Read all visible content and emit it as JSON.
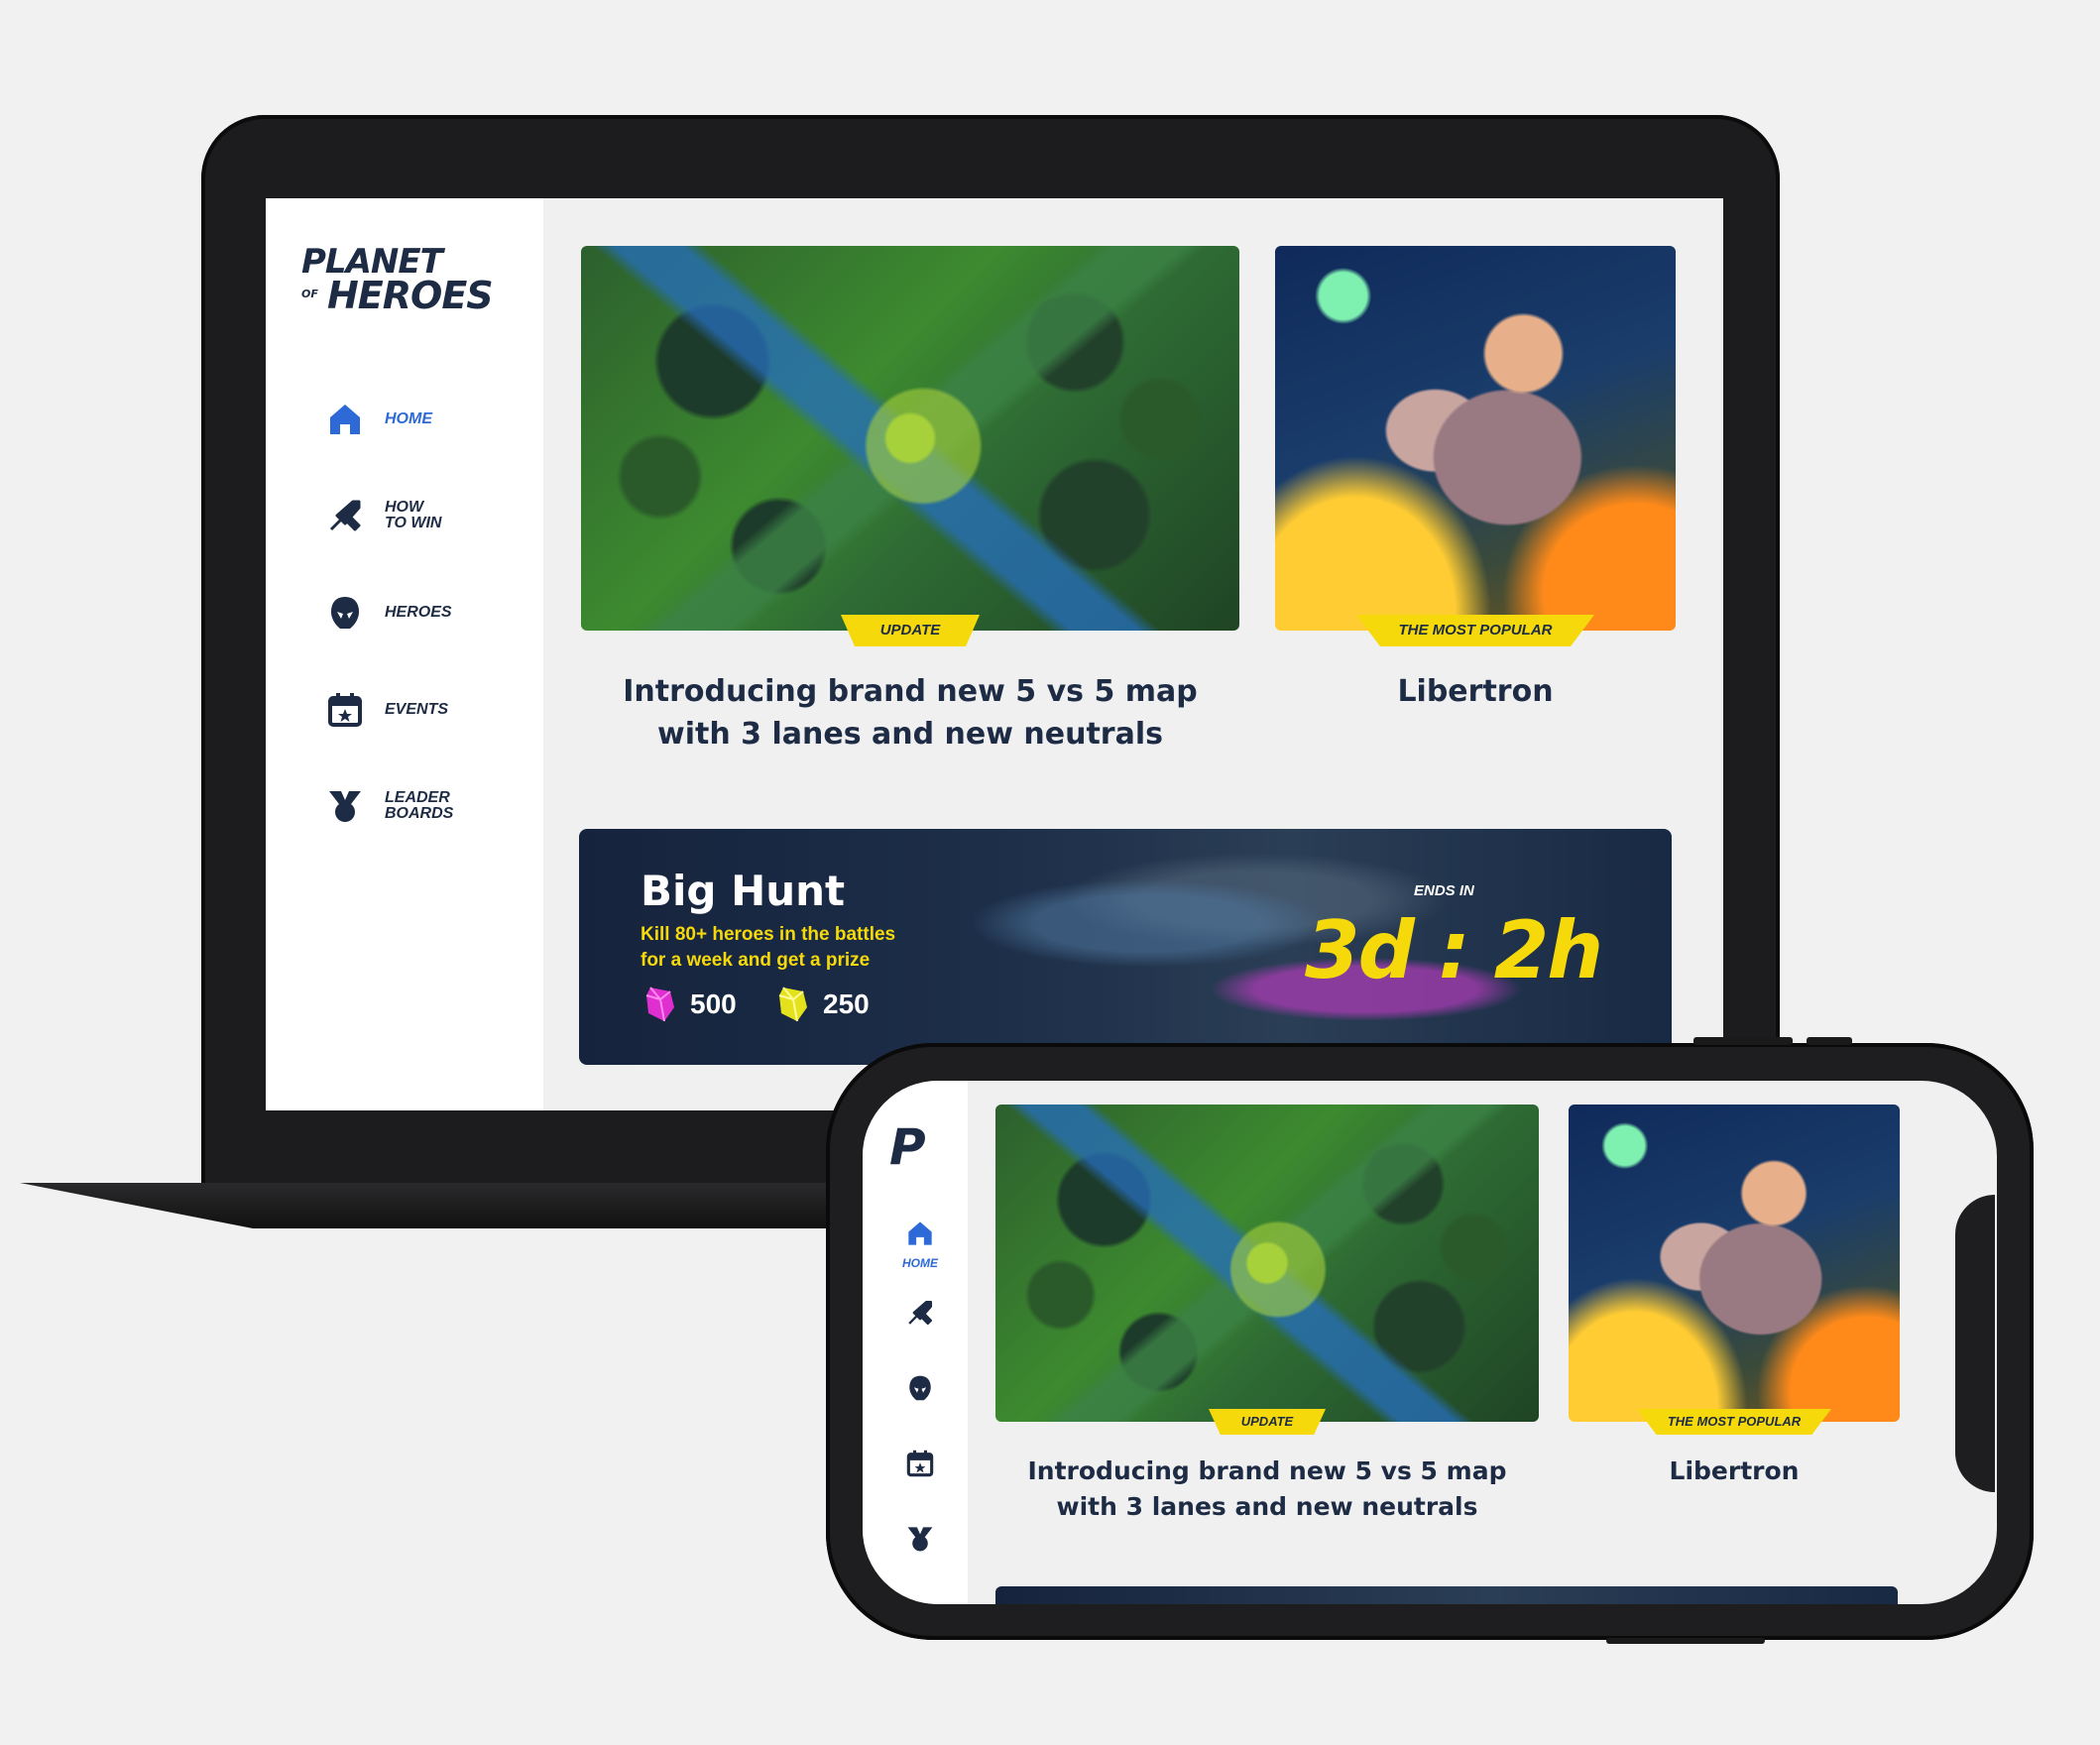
{
  "brand": {
    "logo_line1": "PLANET",
    "logo_of": "OF",
    "logo_line2": "HEROES",
    "mobile_logo": "P"
  },
  "colors": {
    "accent_blue": "#2d6ad7",
    "badge_yellow": "#f5d90a",
    "navy_text": "#1d2b44",
    "gem_pink": "#e02fd0",
    "gem_yellow": "#e4e21d"
  },
  "nav": {
    "items": [
      {
        "id": "home",
        "label": "HOME",
        "icon": "home-icon",
        "active": true
      },
      {
        "id": "how-to-win",
        "label": "HOW\nTO WIN",
        "icon": "crossed-swords-icon",
        "active": false
      },
      {
        "id": "heroes",
        "label": "HEROES",
        "icon": "hero-helmet-icon",
        "active": false
      },
      {
        "id": "events",
        "label": "EVENTS",
        "icon": "calendar-star-icon",
        "active": false
      },
      {
        "id": "leaderboards",
        "label": "LEADER\nBOARDS",
        "icon": "medal-icon",
        "active": false
      }
    ]
  },
  "cards": {
    "news": {
      "badge": "UPDATE",
      "title": "Introducing brand new 5 vs 5 map\nwith 3 lanes and new neutrals"
    },
    "hero": {
      "badge": "THE MOST POPULAR",
      "title": "Libertron"
    }
  },
  "event": {
    "title": "Big Hunt",
    "subtitle": "Kill 80+ heroes in the battles\nfor a week and get a prize",
    "rewards": [
      {
        "gem": "pink-gem-icon",
        "amount": "500"
      },
      {
        "gem": "yellow-gem-icon",
        "amount": "250"
      }
    ],
    "ends_label": "ENDS IN",
    "countdown": "3d : 2h"
  }
}
